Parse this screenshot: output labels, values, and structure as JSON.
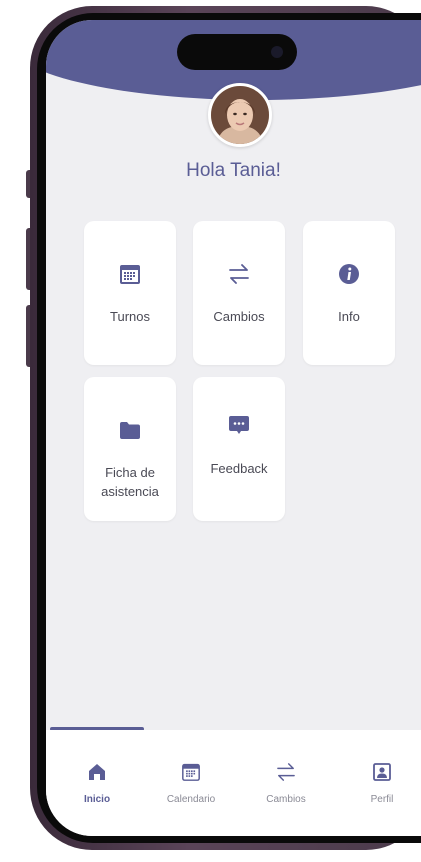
{
  "colors": {
    "accent": "#5a5d95",
    "background": "#efeff2",
    "card": "#ffffff",
    "text": "#4a4a55",
    "muted": "#8a8a95"
  },
  "greeting": "Hola Tania!",
  "menu": {
    "items": [
      {
        "label": "Turnos",
        "icon": "calendar-icon"
      },
      {
        "label": "Cambios",
        "icon": "swap-arrows-icon"
      },
      {
        "label": "Info",
        "icon": "info-icon"
      },
      {
        "label": "Ficha de asistencia",
        "icon": "folder-icon"
      },
      {
        "label": "Feedback",
        "icon": "chat-bubble-icon"
      }
    ]
  },
  "tabbar": {
    "tabs": [
      {
        "label": "Inicio",
        "icon": "home-icon",
        "active": true
      },
      {
        "label": "Calendario",
        "icon": "calendar-icon",
        "active": false
      },
      {
        "label": "Cambios",
        "icon": "swap-arrows-icon",
        "active": false
      },
      {
        "label": "Perfil",
        "icon": "profile-icon",
        "active": false
      }
    ]
  }
}
